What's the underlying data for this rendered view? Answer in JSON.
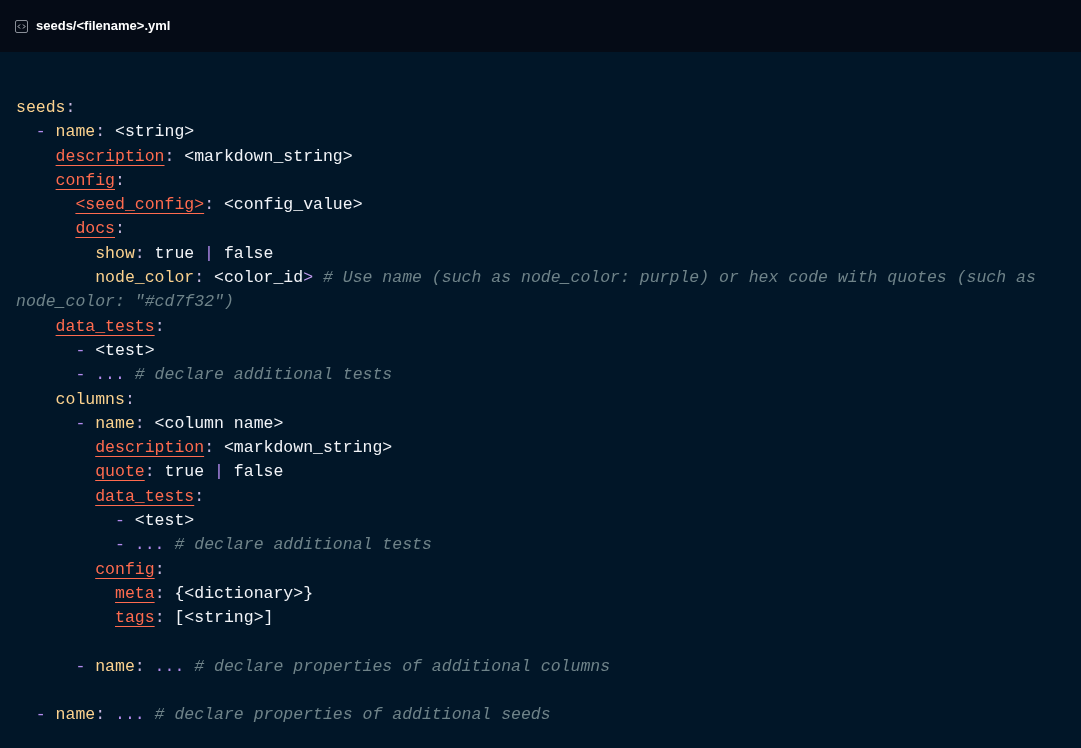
{
  "header": {
    "title": "seeds/<filename>.yml"
  },
  "code_lines": [
    {
      "kind": "line",
      "tokens": [
        {
          "kind": "key",
          "text": "seeds"
        },
        {
          "kind": "colon",
          "text": ":"
        }
      ],
      "children": [
        {
          "kind": "line",
          "tokens": [
            {
              "kind": "dash",
              "text": "-"
            },
            {
              "kind": "key",
              "text": "name"
            },
            {
              "kind": "colon",
              "text": ":"
            },
            {
              "kind": "value",
              "text": "<string>"
            }
          ],
          "children": [
            {
              "kind": "line",
              "tokens": [
                {
                  "kind": "link",
                  "text": "description"
                },
                {
                  "kind": "colon",
                  "text": ":"
                },
                {
                  "kind": "value",
                  "text": "<markdown_string>"
                }
              ]
            },
            {
              "kind": "line",
              "tokens": [
                {
                  "kind": "link",
                  "text": "config"
                },
                {
                  "kind": "colon",
                  "text": ":"
                }
              ],
              "children": [
                {
                  "kind": "line",
                  "tokens": [
                    {
                      "kind": "link",
                      "text": "<seed_config>"
                    },
                    {
                      "kind": "colon",
                      "text": ":"
                    },
                    {
                      "kind": "value",
                      "text": "<config_value>"
                    }
                  ]
                },
                {
                  "kind": "line",
                  "tokens": [
                    {
                      "kind": "link",
                      "text": "docs"
                    },
                    {
                      "kind": "colon",
                      "text": ":"
                    }
                  ],
                  "children": [
                    {
                      "kind": "line",
                      "tokens": [
                        {
                          "kind": "key",
                          "text": "show"
                        },
                        {
                          "kind": "colon",
                          "text": ":"
                        },
                        {
                          "kind": "value",
                          "text": "true"
                        },
                        {
                          "kind": "bar",
                          "text": "|"
                        },
                        {
                          "kind": "value",
                          "text": "false"
                        }
                      ]
                    },
                    {
                      "kind": "line",
                      "tokens": [
                        {
                          "kind": "key",
                          "text": "node_color"
                        },
                        {
                          "kind": "colon",
                          "text": ":"
                        },
                        {
                          "kind": "value",
                          "text": "<color_id"
                        },
                        {
                          "kind": "close",
                          "text": ">"
                        },
                        {
                          "kind": "comment",
                          "text": "# Use name (such as node_color: purple) or hex code with quotes (such as"
                        }
                      ],
                      "wrapped_comment": "node_color: \"#cd7f32\")"
                    }
                  ]
                }
              ]
            },
            {
              "kind": "line",
              "tokens": [
                {
                  "kind": "link",
                  "text": "data_tests"
                },
                {
                  "kind": "colon",
                  "text": ":"
                }
              ],
              "children": [
                {
                  "kind": "line",
                  "tokens": [
                    {
                      "kind": "dash",
                      "text": "-"
                    },
                    {
                      "kind": "value",
                      "text": "<test>"
                    }
                  ]
                },
                {
                  "kind": "line",
                  "tokens": [
                    {
                      "kind": "dash",
                      "text": "-"
                    },
                    {
                      "kind": "ellipsis",
                      "text": "..."
                    },
                    {
                      "kind": "comment",
                      "text": "# declare additional tests"
                    }
                  ]
                }
              ]
            },
            {
              "kind": "line",
              "tokens": [
                {
                  "kind": "key",
                  "text": "columns"
                },
                {
                  "kind": "colon",
                  "text": ":"
                }
              ],
              "children": [
                {
                  "kind": "line",
                  "tokens": [
                    {
                      "kind": "dash",
                      "text": "-"
                    },
                    {
                      "kind": "key",
                      "text": "name"
                    },
                    {
                      "kind": "colon",
                      "text": ":"
                    },
                    {
                      "kind": "value",
                      "text": "<column name>"
                    }
                  ],
                  "children": [
                    {
                      "kind": "line",
                      "tokens": [
                        {
                          "kind": "link",
                          "text": "description"
                        },
                        {
                          "kind": "colon",
                          "text": ":"
                        },
                        {
                          "kind": "value",
                          "text": "<markdown_string>"
                        }
                      ]
                    },
                    {
                      "kind": "line",
                      "tokens": [
                        {
                          "kind": "link",
                          "text": "quote"
                        },
                        {
                          "kind": "colon",
                          "text": ":"
                        },
                        {
                          "kind": "value",
                          "text": "true"
                        },
                        {
                          "kind": "bar",
                          "text": "|"
                        },
                        {
                          "kind": "value",
                          "text": "false"
                        }
                      ]
                    },
                    {
                      "kind": "line",
                      "tokens": [
                        {
                          "kind": "link",
                          "text": "data_tests"
                        },
                        {
                          "kind": "colon",
                          "text": ":"
                        }
                      ],
                      "children": [
                        {
                          "kind": "line",
                          "tokens": [
                            {
                              "kind": "dash",
                              "text": "-"
                            },
                            {
                              "kind": "value",
                              "text": "<test>"
                            }
                          ]
                        },
                        {
                          "kind": "line",
                          "tokens": [
                            {
                              "kind": "dash",
                              "text": "-"
                            },
                            {
                              "kind": "ellipsis",
                              "text": "..."
                            },
                            {
                              "kind": "comment",
                              "text": "# declare additional tests"
                            }
                          ]
                        }
                      ]
                    },
                    {
                      "kind": "line",
                      "tokens": [
                        {
                          "kind": "link",
                          "text": "config"
                        },
                        {
                          "kind": "colon",
                          "text": ":"
                        }
                      ],
                      "children": [
                        {
                          "kind": "line",
                          "tokens": [
                            {
                              "kind": "link",
                              "text": "meta"
                            },
                            {
                              "kind": "colon",
                              "text": ":"
                            },
                            {
                              "kind": "value",
                              "text": "{<dictionary>}"
                            }
                          ]
                        },
                        {
                          "kind": "line",
                          "tokens": [
                            {
                              "kind": "link",
                              "text": "tags"
                            },
                            {
                              "kind": "colon",
                              "text": ":"
                            },
                            {
                              "kind": "value",
                              "text": "[<string>]"
                            }
                          ]
                        }
                      ]
                    },
                    {
                      "kind": "blank"
                    }
                  ]
                },
                {
                  "kind": "line",
                  "tokens": [
                    {
                      "kind": "dash",
                      "text": "-"
                    },
                    {
                      "kind": "key",
                      "text": "name"
                    },
                    {
                      "kind": "colon",
                      "text": ":"
                    },
                    {
                      "kind": "ellipsis",
                      "text": "..."
                    },
                    {
                      "kind": "comment",
                      "text": "# declare properties of additional columns"
                    }
                  ]
                }
              ]
            },
            {
              "kind": "blank"
            }
          ]
        },
        {
          "kind": "line",
          "tokens": [
            {
              "kind": "dash",
              "text": "-"
            },
            {
              "kind": "key",
              "text": "name"
            },
            {
              "kind": "colon",
              "text": ":"
            },
            {
              "kind": "ellipsis",
              "text": "..."
            },
            {
              "kind": "comment",
              "text": "# declare properties of additional seeds"
            }
          ]
        }
      ]
    }
  ]
}
